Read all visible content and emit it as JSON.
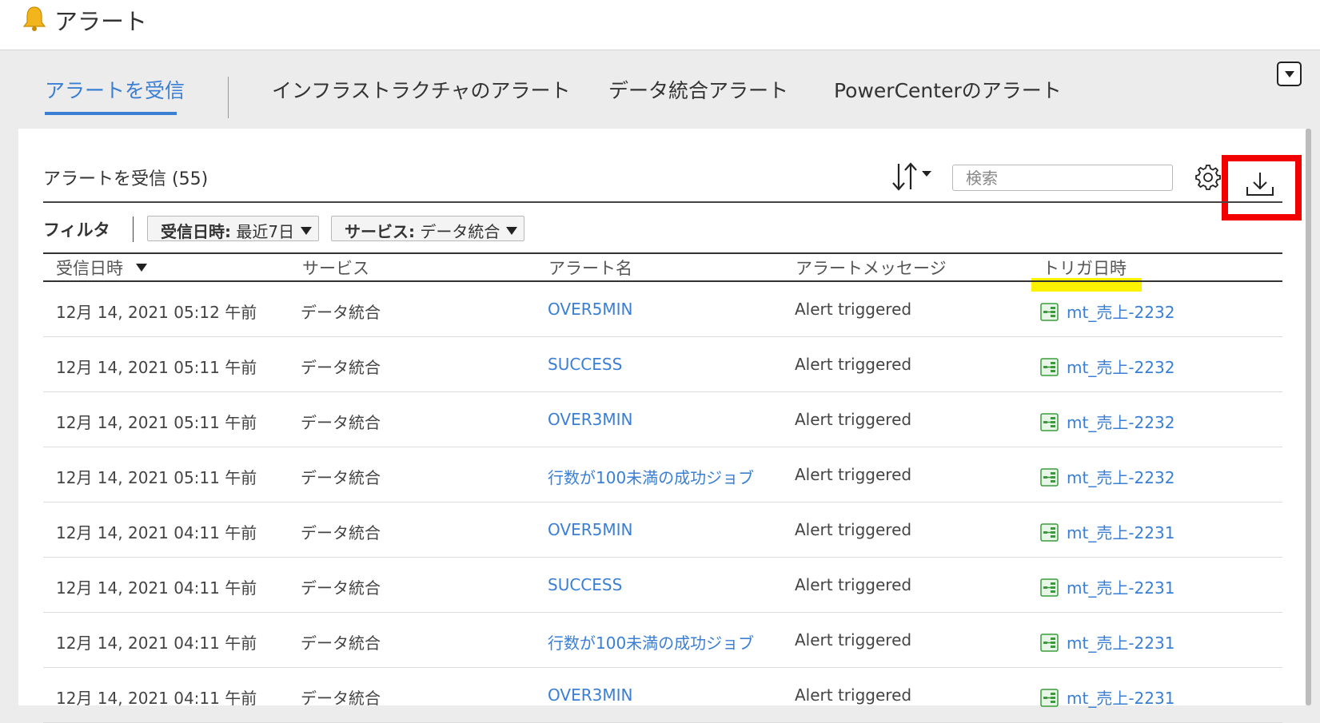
{
  "app": {
    "title": "アラート"
  },
  "tabs": [
    {
      "label": "アラートを受信",
      "active": true
    },
    {
      "label": "インフラストラクチャのアラート",
      "active": false
    },
    {
      "label": "データ統合アラート",
      "active": false
    },
    {
      "label": "PowerCenterのアラート",
      "active": false
    }
  ],
  "panel": {
    "title": "アラートを受信 (55)",
    "search_placeholder": "検索"
  },
  "filter": {
    "label": "フィルタ",
    "chips": [
      {
        "key": "受信日時:",
        "value": " 最近7日"
      },
      {
        "key": "サービス:",
        "value": " データ統合"
      }
    ]
  },
  "table": {
    "headers": [
      "受信日時",
      "サービス",
      "アラート名",
      "アラートメッセージ",
      "トリガ日時"
    ],
    "rows": [
      {
        "date": "12月 14, 2021 05:12 午前",
        "service": "データ統合",
        "name": "OVER5MIN",
        "message": "Alert triggered",
        "trigger": "mt_売上-2232"
      },
      {
        "date": "12月 14, 2021 05:11 午前",
        "service": "データ統合",
        "name": "SUCCESS",
        "message": "Alert triggered",
        "trigger": "mt_売上-2232"
      },
      {
        "date": "12月 14, 2021 05:11 午前",
        "service": "データ統合",
        "name": "OVER3MIN",
        "message": "Alert triggered",
        "trigger": "mt_売上-2232"
      },
      {
        "date": "12月 14, 2021 05:11 午前",
        "service": "データ統合",
        "name": "行数が100未満の成功ジョブ",
        "message": "Alert triggered",
        "trigger": "mt_売上-2232"
      },
      {
        "date": "12月 14, 2021 04:11 午前",
        "service": "データ統合",
        "name": "OVER5MIN",
        "message": "Alert triggered",
        "trigger": "mt_売上-2231"
      },
      {
        "date": "12月 14, 2021 04:11 午前",
        "service": "データ統合",
        "name": "SUCCESS",
        "message": "Alert triggered",
        "trigger": "mt_売上-2231"
      },
      {
        "date": "12月 14, 2021 04:11 午前",
        "service": "データ統合",
        "name": "行数が100未満の成功ジョブ",
        "message": "Alert triggered",
        "trigger": "mt_売上-2231"
      },
      {
        "date": "12月 14, 2021 04:11 午前",
        "service": "データ統合",
        "name": "OVER3MIN",
        "message": "Alert triggered",
        "trigger": "mt_売上-2231"
      }
    ]
  },
  "icons": {
    "app": "bell-icon",
    "sort": "sort-icon",
    "settings": "gear-icon",
    "download": "download-icon",
    "mapping": "mapping-task-icon"
  },
  "colors": {
    "accent": "#3a7fd4",
    "highlight_box": "#f20000",
    "highlight_marker": "#fff200",
    "mapping_icon": "#3a9b3a"
  }
}
